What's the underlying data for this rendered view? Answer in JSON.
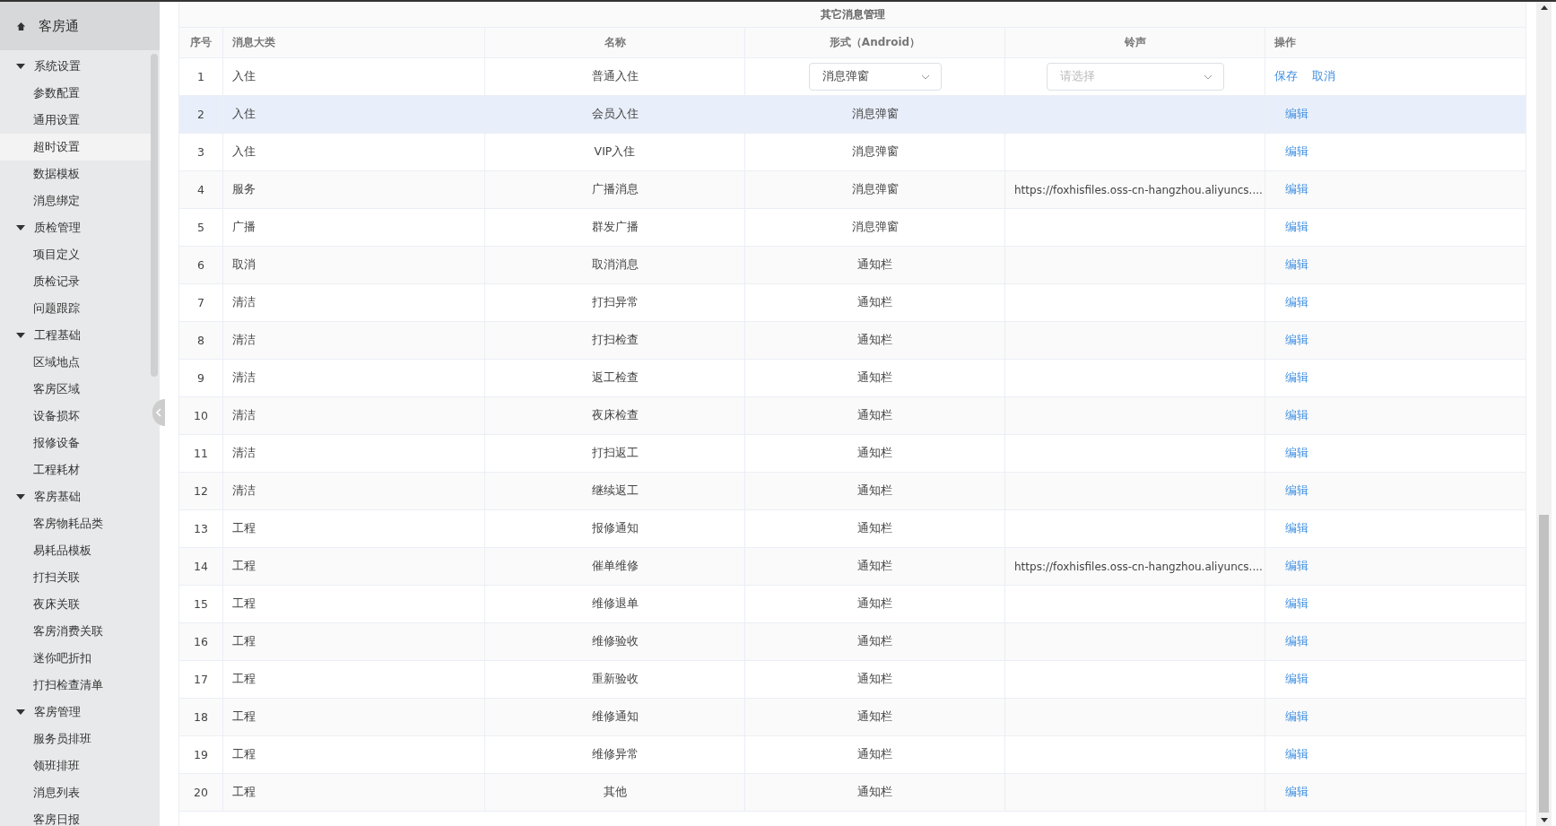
{
  "sidebar": {
    "title": "客房通",
    "groups": [
      {
        "label": "系统设置",
        "expanded": true,
        "children": [
          {
            "label": "参数配置",
            "selected": false
          },
          {
            "label": "通用设置",
            "selected": false
          },
          {
            "label": "超时设置",
            "selected": true
          },
          {
            "label": "数据模板",
            "selected": false
          },
          {
            "label": "消息绑定",
            "selected": false
          }
        ]
      },
      {
        "label": "质检管理",
        "expanded": true,
        "children": [
          {
            "label": "项目定义",
            "selected": false
          },
          {
            "label": "质检记录",
            "selected": false
          },
          {
            "label": "问题跟踪",
            "selected": false
          }
        ]
      },
      {
        "label": "工程基础",
        "expanded": true,
        "children": [
          {
            "label": "区域地点",
            "selected": false
          },
          {
            "label": "客房区域",
            "selected": false
          },
          {
            "label": "设备损坏",
            "selected": false
          },
          {
            "label": "报修设备",
            "selected": false
          },
          {
            "label": "工程耗材",
            "selected": false
          }
        ]
      },
      {
        "label": "客房基础",
        "expanded": true,
        "children": [
          {
            "label": "客房物耗品类",
            "selected": false
          },
          {
            "label": "易耗品模板",
            "selected": false
          },
          {
            "label": "打扫关联",
            "selected": false
          },
          {
            "label": "夜床关联",
            "selected": false
          },
          {
            "label": "客房消费关联",
            "selected": false
          },
          {
            "label": "迷你吧折扣",
            "selected": false
          },
          {
            "label": "打扫检查清单",
            "selected": false
          }
        ]
      },
      {
        "label": "客房管理",
        "expanded": true,
        "children": [
          {
            "label": "服务员排班",
            "selected": false
          },
          {
            "label": "领班排班",
            "selected": false
          },
          {
            "label": "消息列表",
            "selected": false
          },
          {
            "label": "客房日报",
            "selected": false
          }
        ]
      }
    ]
  },
  "table": {
    "title": "其它消息管理",
    "columns": [
      "序号",
      "消息大类",
      "名称",
      "形式（Android）",
      "铃声",
      "操作"
    ],
    "rows": [
      {
        "kind": "edit",
        "hovered": false,
        "index": "1",
        "category": "入住",
        "name": "普通入住",
        "form": "消息弹窗",
        "ringtone_placeholder": "请选择",
        "actions": [
          "保存",
          "取消"
        ]
      },
      {
        "kind": "view",
        "hovered": true,
        "index": "2",
        "category": "入住",
        "name": "会员入住",
        "form": "消息弹窗",
        "ringtone": "",
        "actions": [
          "编辑"
        ]
      },
      {
        "kind": "view",
        "hovered": false,
        "index": "3",
        "category": "入住",
        "name": "VIP入住",
        "form": "消息弹窗",
        "ringtone": "",
        "actions": [
          "编辑"
        ]
      },
      {
        "kind": "view",
        "hovered": false,
        "index": "4",
        "category": "服务",
        "name": "广播消息",
        "form": "消息弹窗",
        "ringtone": "https://foxhisfiles.oss-cn-hangzhou.aliyuncs....",
        "actions": [
          "编辑"
        ]
      },
      {
        "kind": "view",
        "hovered": false,
        "index": "5",
        "category": "广播",
        "name": "群发广播",
        "form": "消息弹窗",
        "ringtone": "",
        "actions": [
          "编辑"
        ]
      },
      {
        "kind": "view",
        "hovered": false,
        "index": "6",
        "category": "取消",
        "name": "取消消息",
        "form": "通知栏",
        "ringtone": "",
        "actions": [
          "编辑"
        ]
      },
      {
        "kind": "view",
        "hovered": false,
        "index": "7",
        "category": "清洁",
        "name": "打扫异常",
        "form": "通知栏",
        "ringtone": "",
        "actions": [
          "编辑"
        ]
      },
      {
        "kind": "view",
        "hovered": false,
        "index": "8",
        "category": "清洁",
        "name": "打扫检查",
        "form": "通知栏",
        "ringtone": "",
        "actions": [
          "编辑"
        ]
      },
      {
        "kind": "view",
        "hovered": false,
        "index": "9",
        "category": "清洁",
        "name": "返工检查",
        "form": "通知栏",
        "ringtone": "",
        "actions": [
          "编辑"
        ]
      },
      {
        "kind": "view",
        "hovered": false,
        "index": "10",
        "category": "清洁",
        "name": "夜床检查",
        "form": "通知栏",
        "ringtone": "",
        "actions": [
          "编辑"
        ]
      },
      {
        "kind": "view",
        "hovered": false,
        "index": "11",
        "category": "清洁",
        "name": "打扫返工",
        "form": "通知栏",
        "ringtone": "",
        "actions": [
          "编辑"
        ]
      },
      {
        "kind": "view",
        "hovered": false,
        "index": "12",
        "category": "清洁",
        "name": "继续返工",
        "form": "通知栏",
        "ringtone": "",
        "actions": [
          "编辑"
        ]
      },
      {
        "kind": "view",
        "hovered": false,
        "index": "13",
        "category": "工程",
        "name": "报修通知",
        "form": "通知栏",
        "ringtone": "",
        "actions": [
          "编辑"
        ]
      },
      {
        "kind": "view",
        "hovered": false,
        "index": "14",
        "category": "工程",
        "name": "催单维修",
        "form": "通知栏",
        "ringtone": "https://foxhisfiles.oss-cn-hangzhou.aliyuncs....",
        "actions": [
          "编辑"
        ]
      },
      {
        "kind": "view",
        "hovered": false,
        "index": "15",
        "category": "工程",
        "name": "维修退单",
        "form": "通知栏",
        "ringtone": "",
        "actions": [
          "编辑"
        ]
      },
      {
        "kind": "view",
        "hovered": false,
        "index": "16",
        "category": "工程",
        "name": "维修验收",
        "form": "通知栏",
        "ringtone": "",
        "actions": [
          "编辑"
        ]
      },
      {
        "kind": "view",
        "hovered": false,
        "index": "17",
        "category": "工程",
        "name": "重新验收",
        "form": "通知栏",
        "ringtone": "",
        "actions": [
          "编辑"
        ]
      },
      {
        "kind": "view",
        "hovered": false,
        "index": "18",
        "category": "工程",
        "name": "维修通知",
        "form": "通知栏",
        "ringtone": "",
        "actions": [
          "编辑"
        ]
      },
      {
        "kind": "view",
        "hovered": false,
        "index": "19",
        "category": "工程",
        "name": "维修异常",
        "form": "通知栏",
        "ringtone": "",
        "actions": [
          "编辑"
        ]
      },
      {
        "kind": "view",
        "hovered": false,
        "index": "20",
        "category": "工程",
        "name": "其他",
        "form": "通知栏",
        "ringtone": "",
        "actions": [
          "编辑"
        ]
      }
    ]
  }
}
